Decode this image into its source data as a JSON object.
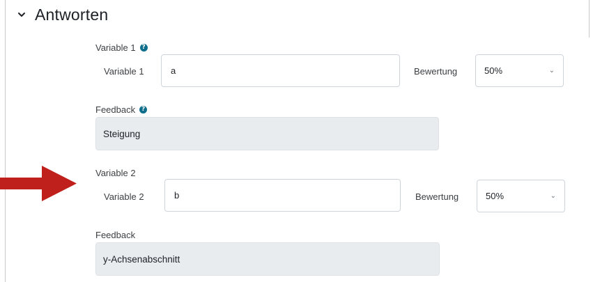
{
  "section": {
    "title": "Antworten",
    "chevron_icon": "chevron-down-icon"
  },
  "answers": [
    {
      "group_label": "Variable 1",
      "has_help": true,
      "field_label": "Variable 1",
      "value": "a",
      "grade_label": "Bewertung",
      "grade_value": "50%",
      "feedback_label": "Feedback",
      "feedback_has_help": true,
      "feedback_value": "Steigung"
    },
    {
      "group_label": "Variable 2",
      "has_help": false,
      "field_label": "Variable 2",
      "value": "b",
      "grade_label": "Bewertung",
      "grade_value": "50%",
      "feedback_label": "Feedback",
      "feedback_has_help": false,
      "feedback_value": "y-Achsenabschnitt"
    }
  ],
  "help_icon_glyph": "?",
  "select_caret": "⌄",
  "colors": {
    "annotation_arrow": "#c0201c",
    "help_icon": "#0f6e8c",
    "readonly_bg": "#e9ecef"
  }
}
